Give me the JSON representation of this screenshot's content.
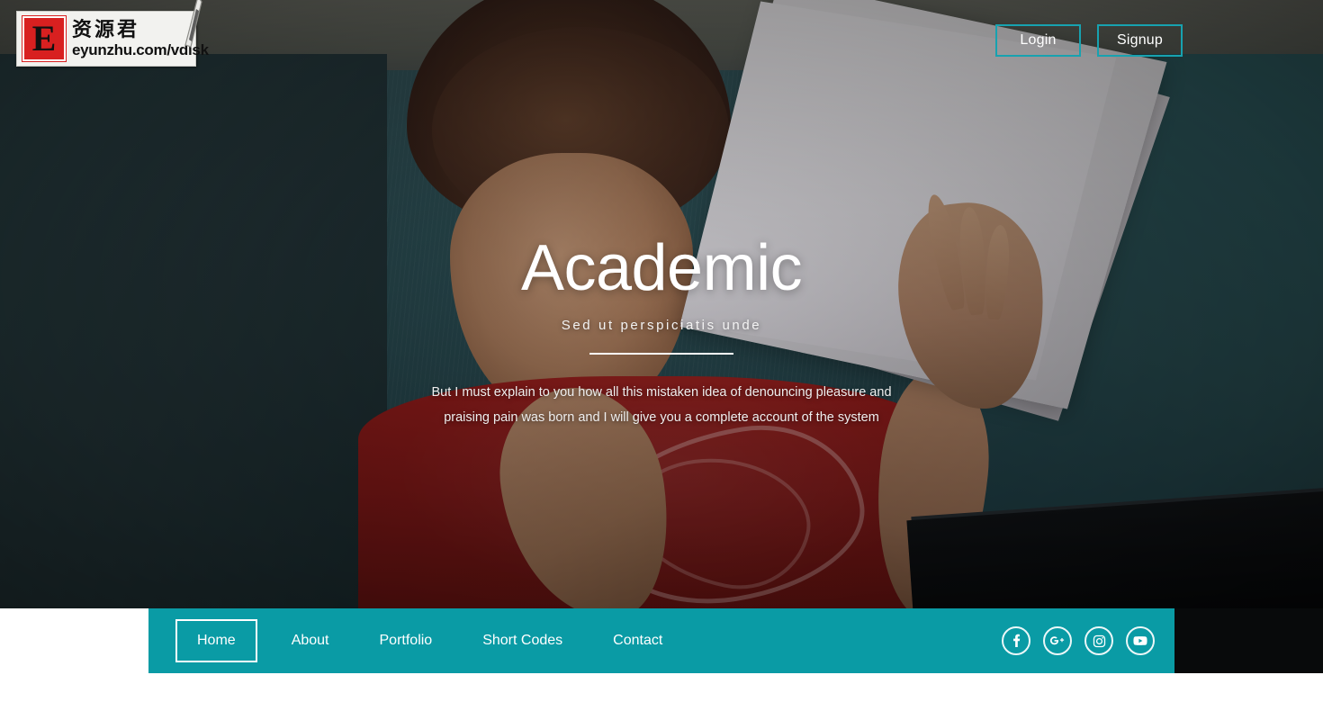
{
  "watermark": {
    "letter": "E",
    "chinese": "资源君",
    "url": "eyunzhu.com/vdisk"
  },
  "topbar": {
    "login_label": "Login",
    "signup_label": "Signup",
    "button_border_color": "#17a2b0"
  },
  "hero": {
    "title": "Academic",
    "subtitle": "Sed ut perspiciatis unde",
    "paragraph": "But I must explain to you how all this mistaken idea of denouncing pleasure and praising pain was born and I will give you a complete account of the system"
  },
  "nav": {
    "background_color": "#0a9ba5",
    "items": [
      {
        "label": "Home",
        "active": true
      },
      {
        "label": "About",
        "active": false
      },
      {
        "label": "Portfolio",
        "active": false
      },
      {
        "label": "Short Codes",
        "active": false
      },
      {
        "label": "Contact",
        "active": false
      }
    ],
    "social": [
      {
        "name": "facebook",
        "glyph": "f"
      },
      {
        "name": "google-plus",
        "glyph": "g+"
      },
      {
        "name": "instagram",
        "glyph": "camera"
      },
      {
        "name": "youtube",
        "glyph": "play"
      }
    ]
  }
}
